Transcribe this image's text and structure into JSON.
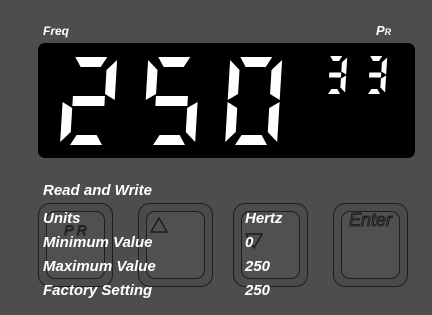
{
  "display": {
    "mode_label": "Freq",
    "param_label_main": "P",
    "param_label_sub": "R",
    "value": "250",
    "param_number": "33"
  },
  "keys": {
    "pr_label": "P R",
    "enter_label": "Enter"
  },
  "info": {
    "access": "Read and Write",
    "rows": [
      {
        "label": "Units",
        "value": "Hertz"
      },
      {
        "label": "Minimum Value",
        "value": "0"
      },
      {
        "label": "Maximum Value",
        "value": "250"
      },
      {
        "label": "Factory Setting",
        "value": "250"
      }
    ]
  },
  "colors": {
    "panel": "#4d4d4d",
    "display_bg": "#000000",
    "segment": "#ffffff",
    "text": "#ffffff"
  }
}
